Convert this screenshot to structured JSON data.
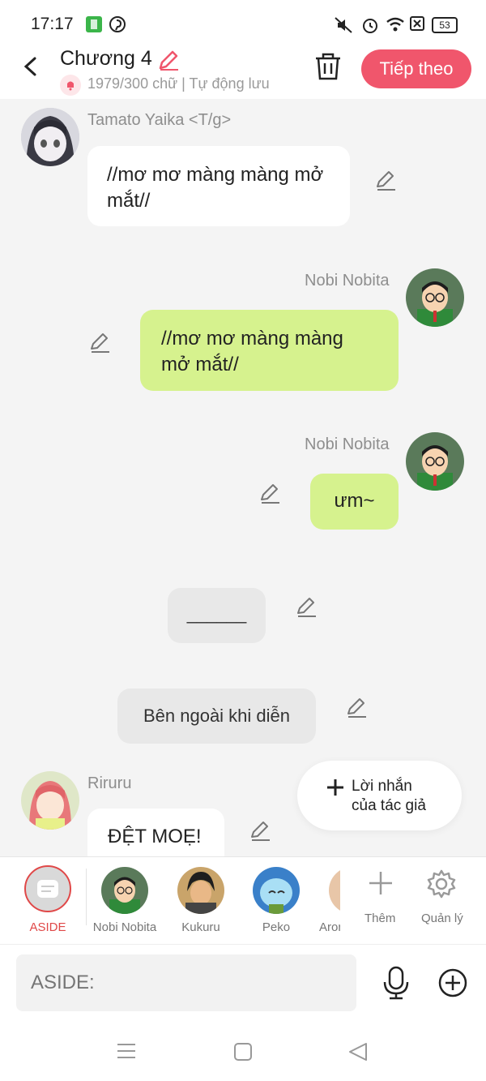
{
  "status_bar": {
    "time": "17:17",
    "battery": "53",
    "icons": [
      "sim-app-icon",
      "pinterest-icon",
      "mute-icon",
      "alarm-icon",
      "wifi-icon",
      "sim-off-icon",
      "battery-icon"
    ]
  },
  "header": {
    "title": "Chương 4",
    "subtitle": "1979/300 chữ | Tự động lưu",
    "next_label": "Tiếp theo"
  },
  "messages": [
    {
      "sender": "Tamato Yaika <T/g>",
      "text": "//mơ mơ màng màng mở mắt//",
      "side": "left"
    },
    {
      "sender": "Nobi Nobita",
      "text": "//mơ mơ màng màng mở mắt//",
      "side": "right"
    },
    {
      "sender": "Nobi Nobita",
      "text": "ưm~",
      "side": "right"
    },
    {
      "sender": "",
      "text": "______",
      "side": "center"
    },
    {
      "sender": "",
      "text": "Bên ngoài khi diễn",
      "side": "center"
    },
    {
      "sender": "Riruru",
      "text": "ĐỆT MOẸ!",
      "side": "left"
    }
  ],
  "author_note": {
    "line1": "Lời nhắn",
    "line2": "của tác giả"
  },
  "characters": [
    {
      "name": "ASIDE"
    },
    {
      "name": "Nobi Nobita"
    },
    {
      "name": "Kukuru"
    },
    {
      "name": "Peko"
    },
    {
      "name": "Aron"
    }
  ],
  "actions": {
    "add_label": "Thêm",
    "manage_label": "Quản lý"
  },
  "input": {
    "placeholder": "ASIDE:"
  },
  "colors": {
    "accent": "#f0566c",
    "green_bubble": "#d6f28e",
    "aside_active": "#e04848"
  }
}
